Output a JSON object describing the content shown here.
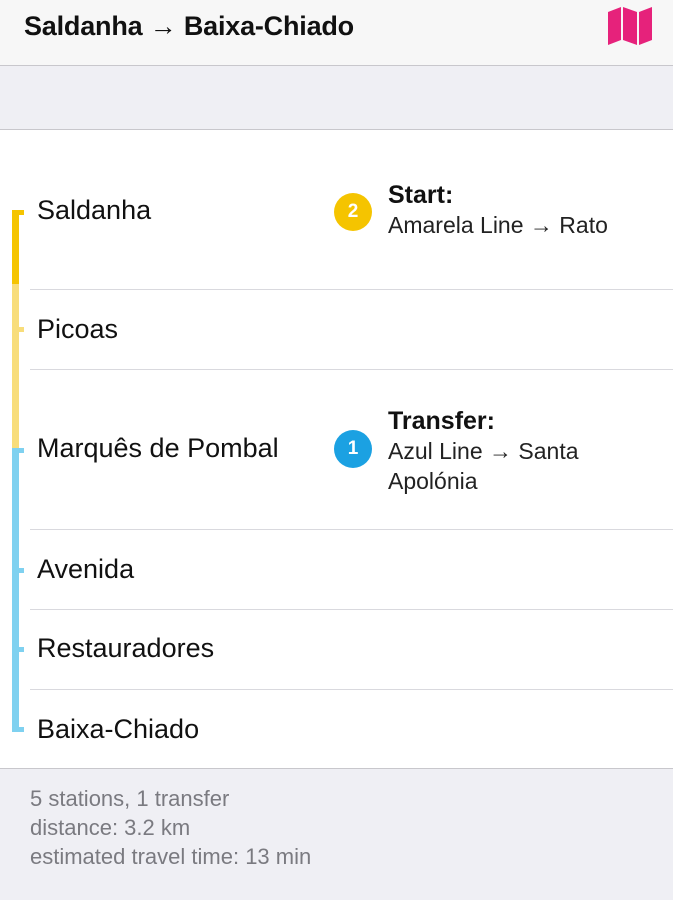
{
  "header": {
    "title": "Saldanha → Baixa-Chiado",
    "map_icon": "map-icon",
    "accent_color": "#e6227b"
  },
  "route": {
    "stations": [
      {
        "name": "Saldanha"
      },
      {
        "name": "Picoas"
      },
      {
        "name": "Marquês de Pombal"
      },
      {
        "name": "Avenida"
      },
      {
        "name": "Restauradores"
      },
      {
        "name": "Baixa-Chiado"
      }
    ],
    "events": {
      "start": {
        "badge": "2",
        "title": "Start:",
        "text": "Amarela Line → Rato",
        "color": "#f5c400"
      },
      "transfer": {
        "badge": "1",
        "title": "Transfer:",
        "text": "Azul Line → Santa Apolónia",
        "color": "#1ba1e2"
      }
    },
    "line_colors": {
      "amarela_active": "#f5c400",
      "amarela_light": "#f8dd7a",
      "azul_light": "#7fd1f0"
    }
  },
  "summary": {
    "stations": "5 stations, 1 transfer",
    "distance": "distance: 3.2 km",
    "time": "estimated travel time: 13 min"
  }
}
